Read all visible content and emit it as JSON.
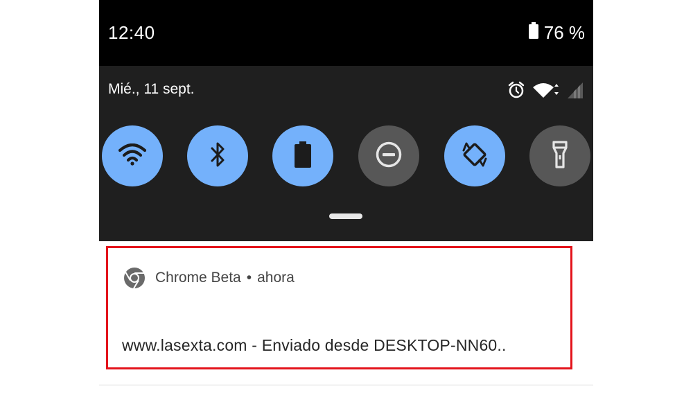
{
  "status_bar": {
    "time": "12:40",
    "battery_percent": "76 %",
    "battery_icon": "battery-icon"
  },
  "quick_settings": {
    "date": "Mié., 11 sept.",
    "status_icons": [
      "alarm-icon",
      "wifi-signal-icon",
      "cell-signal-icon"
    ],
    "tiles": [
      {
        "name": "wifi-icon",
        "state": "on"
      },
      {
        "name": "bluetooth-icon",
        "state": "on"
      },
      {
        "name": "battery-saver-icon",
        "state": "on"
      },
      {
        "name": "do-not-disturb-icon",
        "state": "off"
      },
      {
        "name": "auto-rotate-icon",
        "state": "on"
      },
      {
        "name": "flashlight-icon",
        "state": "off"
      }
    ]
  },
  "notification": {
    "app_name": "Chrome Beta",
    "separator": "•",
    "time": "ahora",
    "app_icon": "chrome-icon",
    "body": "www.lasexta.com - Enviado desde DESKTOP-NN60.."
  },
  "colors": {
    "status_bar_bg": "#000000",
    "panel_bg": "#1f1f1f",
    "tile_on": "#74b1fb",
    "tile_off": "#575757",
    "highlight_border": "#e3131b"
  }
}
